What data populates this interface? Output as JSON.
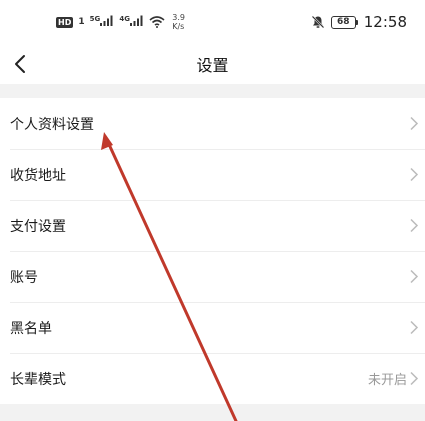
{
  "status_bar": {
    "hd_badge": "HD",
    "sim_number": "1",
    "network_1": "5G",
    "network_2": "4G",
    "speed_value": "3.9",
    "speed_unit": "K/s",
    "battery": "68",
    "time": "12:58"
  },
  "nav": {
    "title": "设置"
  },
  "settings": {
    "items": [
      {
        "label": "个人资料设置",
        "value": ""
      },
      {
        "label": "收货地址",
        "value": ""
      },
      {
        "label": "支付设置",
        "value": ""
      },
      {
        "label": "账号",
        "value": ""
      },
      {
        "label": "黑名单",
        "value": ""
      },
      {
        "label": "长辈模式",
        "value": "未开启"
      }
    ]
  },
  "colors": {
    "annotation_arrow": "#c0392b",
    "chevron": "#bbbbbb"
  }
}
